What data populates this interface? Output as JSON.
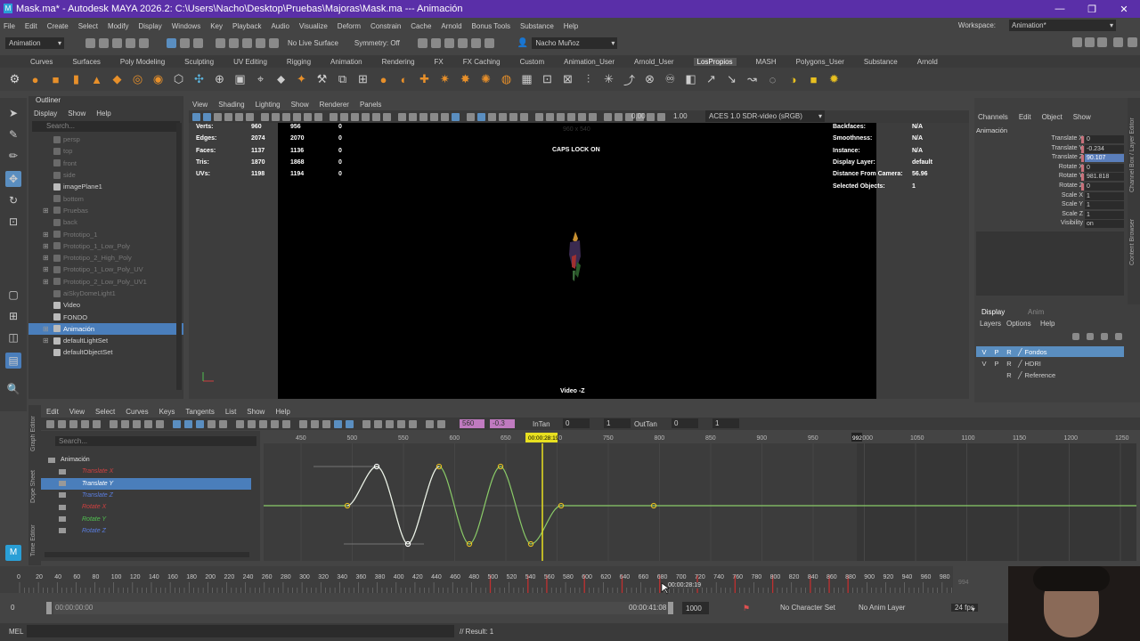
{
  "window": {
    "title": "Mask.ma* - Autodesk MAYA 2026.2: C:\\Users\\Nacho\\Desktop\\Pruebas\\Majoras\\Mask.ma --- Animación",
    "minimize": "—",
    "restore": "❐",
    "close": "✕"
  },
  "menu": [
    "File",
    "Edit",
    "Create",
    "Select",
    "Modify",
    "Display",
    "Windows",
    "Key",
    "Playback",
    "Audio",
    "Visualize",
    "Deform",
    "Constrain",
    "Cache",
    "Arnold",
    "Bonus Tools",
    "Substance",
    "Help"
  ],
  "workspace": {
    "label": "Workspace:",
    "value": "Animation*"
  },
  "status": {
    "mode": "Animation",
    "live": "No Live Surface",
    "symmetry": "Symmetry: Off",
    "user": "Nacho Muñoz"
  },
  "shelf_tabs": [
    "Curves",
    "Surfaces",
    "Poly Modeling",
    "Sculpting",
    "UV Editing",
    "Rigging",
    "Animation",
    "Rendering",
    "FX",
    "FX Caching",
    "Custom",
    "Animation_User",
    "Arnold_User",
    "LosPropios",
    "MASH",
    "Polygons_User",
    "Substance",
    "Arnold"
  ],
  "shelf_active": "LosPropios",
  "outliner": {
    "title": "Outliner",
    "menu": [
      "Display",
      "Show",
      "Help"
    ],
    "search": "Search...",
    "items": [
      {
        "label": "persp",
        "dim": true,
        "exp": ""
      },
      {
        "label": "top",
        "dim": true,
        "exp": ""
      },
      {
        "label": "front",
        "dim": true,
        "exp": ""
      },
      {
        "label": "side",
        "dim": true,
        "exp": ""
      },
      {
        "label": "imagePlane1",
        "dim": false,
        "exp": ""
      },
      {
        "label": "bottom",
        "dim": true,
        "exp": ""
      },
      {
        "label": "Pruebas",
        "dim": true,
        "exp": "⊞"
      },
      {
        "label": "back",
        "dim": true,
        "exp": ""
      },
      {
        "label": "Prototipo_1",
        "dim": true,
        "exp": "⊞"
      },
      {
        "label": "Prototipo_1_Low_Poly",
        "dim": true,
        "exp": "⊞"
      },
      {
        "label": "Prototipo_2_High_Poly",
        "dim": true,
        "exp": "⊞"
      },
      {
        "label": "Prototipo_1_Low_Poly_UV",
        "dim": true,
        "exp": "⊞"
      },
      {
        "label": "Prototipo_2_Low_Poly_UV1",
        "dim": true,
        "exp": "⊞"
      },
      {
        "label": "aiSkyDomeLight1",
        "dim": true,
        "exp": ""
      },
      {
        "label": "Video",
        "dim": false,
        "exp": ""
      },
      {
        "label": "FONDO",
        "dim": false,
        "exp": ""
      },
      {
        "label": "Animación",
        "dim": false,
        "exp": "⊞",
        "sel": true
      },
      {
        "label": "defaultLightSet",
        "dim": false,
        "exp": "⊞"
      },
      {
        "label": "defaultObjectSet",
        "dim": false,
        "exp": ""
      }
    ]
  },
  "viewport": {
    "menu": [
      "View",
      "Shading",
      "Lighting",
      "Show",
      "Renderer",
      "Panels"
    ],
    "exposure": "0.00",
    "gamma": "1.00",
    "colorspace": "ACES 1.0 SDR-video (sRGB)",
    "hud_left": [
      {
        "k": "Verts:",
        "a": "960",
        "b": "956",
        "c": "0"
      },
      {
        "k": "Edges:",
        "a": "2074",
        "b": "2070",
        "c": "0"
      },
      {
        "k": "Faces:",
        "a": "1137",
        "b": "1136",
        "c": "0"
      },
      {
        "k": "Tris:",
        "a": "1870",
        "b": "1868",
        "c": "0"
      },
      {
        "k": "UVs:",
        "a": "1198",
        "b": "1194",
        "c": "0"
      }
    ],
    "hud_right": [
      {
        "k": "Backfaces:",
        "v": "N/A"
      },
      {
        "k": "Smoothness:",
        "v": "N/A"
      },
      {
        "k": "Instance:",
        "v": "N/A"
      },
      {
        "k": "Display Layer:",
        "v": "default"
      },
      {
        "k": "Distance From Camera:",
        "v": "56.96"
      },
      {
        "k": "Selected Objects:",
        "v": "1"
      }
    ],
    "resolution": "960 x 540",
    "caps": "CAPS LOCK ON",
    "camera": "Video -Z"
  },
  "channel_box": {
    "menu": [
      "Channels",
      "Edit",
      "Object",
      "Show"
    ],
    "object": "Animación",
    "channels": [
      {
        "label": "Translate X",
        "value": "0",
        "key": true
      },
      {
        "label": "Translate Y",
        "value": "-0.234",
        "key": true
      },
      {
        "label": "Translate Z",
        "value": "90.107",
        "key": true,
        "sel": true
      },
      {
        "label": "Rotate X",
        "value": "0",
        "key": true
      },
      {
        "label": "Rotate Y",
        "value": "981.818",
        "key": true
      },
      {
        "label": "Rotate Z",
        "value": "0",
        "key": true
      },
      {
        "label": "Scale X",
        "value": "1",
        "key": false
      },
      {
        "label": "Scale Y",
        "value": "1",
        "key": false
      },
      {
        "label": "Scale Z",
        "value": "1",
        "key": false
      },
      {
        "label": "Visibility",
        "value": "on",
        "key": false
      }
    ]
  },
  "layer_editor": {
    "tabs": [
      "Display",
      "Anim"
    ],
    "menu": [
      "Layers",
      "Options",
      "Help"
    ],
    "layers": [
      {
        "v": "V",
        "p": "P",
        "r": "R",
        "name": "Fondos",
        "sel": true
      },
      {
        "v": "V",
        "p": "P",
        "r": "R",
        "name": "HDRI",
        "sel": false
      },
      {
        "v": "",
        "p": "",
        "r": "R",
        "name": "Reference",
        "sel": false
      }
    ]
  },
  "side_tabs": {
    "channel": "Channel Box / Layer Editor",
    "content": "Content Browser",
    "graph": "Graph Editor",
    "dope": "Dope Sheet",
    "time": "Time Editor"
  },
  "graph_editor": {
    "menu": [
      "Edit",
      "View",
      "Select",
      "Curves",
      "Keys",
      "Tangents",
      "List",
      "Show",
      "Help"
    ],
    "field1": "560",
    "field2": "-0.3",
    "intan_label": "InTan",
    "intan": "0",
    "intan2": "1",
    "outtan_label": "OutTan",
    "outtan": "0",
    "outtan2": "1",
    "search": "Search...",
    "tree": [
      {
        "label": "Animación",
        "color": "#e0e0e0",
        "sel": false,
        "indent": 0
      },
      {
        "label": "Translate X",
        "color": "#d04040",
        "sel": false,
        "indent": 1
      },
      {
        "label": "Translate Y",
        "color": "#ffffff",
        "sel": true,
        "indent": 1
      },
      {
        "label": "Translate Z",
        "color": "#5a7ee0",
        "sel": false,
        "indent": 1
      },
      {
        "label": "Rotate X",
        "color": "#d04040",
        "sel": false,
        "indent": 1
      },
      {
        "label": "Rotate Y",
        "color": "#50c050",
        "sel": false,
        "indent": 1
      },
      {
        "label": "Rotate Z",
        "color": "#5a7ee0",
        "sel": false,
        "indent": 1
      }
    ],
    "ruler": [
      "450",
      "500",
      "550",
      "600",
      "650",
      "700",
      "750",
      "800",
      "850",
      "900",
      "950",
      "1000",
      "1050",
      "1100",
      "1150",
      "1200",
      "1250"
    ],
    "current": "00:00:28:19",
    "endframe": "992"
  },
  "timeline": {
    "ticks": [
      "0",
      "20",
      "40",
      "60",
      "80",
      "100",
      "120",
      "140",
      "160",
      "180",
      "200",
      "220",
      "240",
      "260",
      "280",
      "300",
      "320",
      "340",
      "360",
      "380",
      "400",
      "420",
      "440",
      "460",
      "480",
      "500",
      "520",
      "540",
      "560",
      "580",
      "600",
      "620",
      "640",
      "660",
      "680",
      "700",
      "720",
      "740",
      "760",
      "780",
      "800",
      "820",
      "840",
      "860",
      "880",
      "900",
      "920",
      "940",
      "960",
      "980"
    ],
    "hover_time": "00:00:28:19",
    "last": "994"
  },
  "range": {
    "start": "0",
    "start_time": "00:00:00:00",
    "end_time": "00:00:41:08",
    "end": "1000",
    "char_set": "No Character Set",
    "anim_layer": "No Anim Layer",
    "fps": "24 fps"
  },
  "cmd": {
    "lang": "MEL",
    "result": "// Result: 1"
  }
}
